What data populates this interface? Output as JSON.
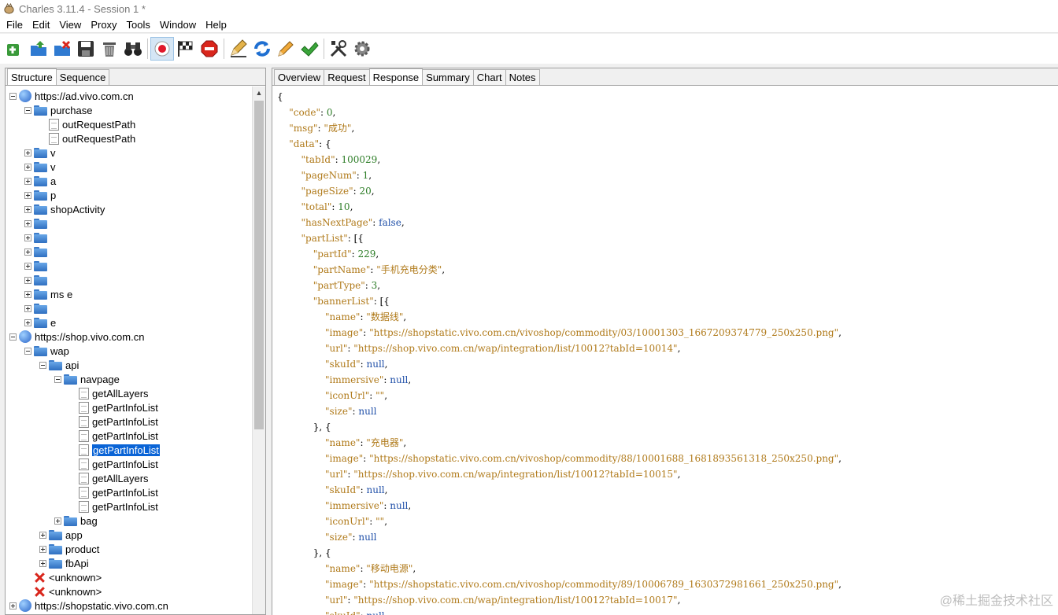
{
  "window": {
    "title": "Charles 3.11.4 - Session 1 *"
  },
  "menu": [
    "File",
    "Edit",
    "View",
    "Proxy",
    "Tools",
    "Window",
    "Help"
  ],
  "toolbar": {
    "buttons": [
      {
        "name": "new-session-icon"
      },
      {
        "name": "open-session-icon"
      },
      {
        "name": "close-session-icon"
      },
      {
        "name": "save-icon"
      },
      {
        "name": "clear-icon"
      },
      {
        "name": "find-icon"
      },
      {
        "name": "record-icon"
      },
      {
        "name": "throttle-icon"
      },
      {
        "name": "breakpoints-icon"
      },
      {
        "name": "compose-icon"
      },
      {
        "name": "repeat-icon"
      },
      {
        "name": "edit-icon"
      },
      {
        "name": "validate-icon"
      },
      {
        "name": "tools-icon"
      },
      {
        "name": "settings-icon"
      }
    ]
  },
  "left_tabs": [
    "Structure",
    "Sequence"
  ],
  "tree": [
    {
      "label": "https://ad.vivo.com.cn",
      "type": "globe",
      "exp": "minus",
      "indent": 0
    },
    {
      "label": "purchase",
      "type": "folder",
      "exp": "minus",
      "indent": 1
    },
    {
      "label": "outRequestPath",
      "type": "file",
      "exp": "none",
      "indent": 2
    },
    {
      "label": "outRequestPath",
      "type": "file",
      "exp": "none",
      "indent": 2
    },
    {
      "label": "v",
      "type": "folder",
      "exp": "plus",
      "indent": 1
    },
    {
      "label": "v",
      "type": "folder",
      "exp": "plus",
      "indent": 1
    },
    {
      "label": "a",
      "type": "folder",
      "exp": "plus",
      "indent": 1
    },
    {
      "label": "p",
      "type": "folder",
      "exp": "plus",
      "indent": 1
    },
    {
      "label": "shopActivity",
      "type": "folder",
      "exp": "plus",
      "indent": 1
    },
    {
      "label": "",
      "type": "folder",
      "exp": "plus",
      "indent": 1
    },
    {
      "label": "",
      "type": "folder",
      "exp": "plus",
      "indent": 1
    },
    {
      "label": "",
      "type": "folder",
      "exp": "plus",
      "indent": 1
    },
    {
      "label": "",
      "type": "folder",
      "exp": "plus",
      "indent": 1
    },
    {
      "label": "",
      "type": "folder",
      "exp": "plus",
      "indent": 1
    },
    {
      "label": "ms e",
      "type": "folder",
      "exp": "plus",
      "indent": 1
    },
    {
      "label": "",
      "type": "folder",
      "exp": "plus",
      "indent": 1
    },
    {
      "label": "e",
      "type": "folder",
      "exp": "plus",
      "indent": 1
    },
    {
      "label": "https://shop.vivo.com.cn",
      "type": "globe",
      "exp": "minus",
      "indent": 0
    },
    {
      "label": "wap",
      "type": "folder",
      "exp": "minus",
      "indent": 1
    },
    {
      "label": "api",
      "type": "folder",
      "exp": "minus",
      "indent": 2
    },
    {
      "label": "navpage",
      "type": "folder",
      "exp": "minus",
      "indent": 3
    },
    {
      "label": "getAllLayers",
      "type": "file",
      "exp": "none",
      "indent": 4
    },
    {
      "label": "getPartInfoList",
      "type": "file",
      "exp": "none",
      "indent": 4
    },
    {
      "label": "getPartInfoList",
      "type": "file",
      "exp": "none",
      "indent": 4
    },
    {
      "label": "getPartInfoList",
      "type": "file",
      "exp": "none",
      "indent": 4
    },
    {
      "label": "getPartInfoList",
      "type": "file",
      "exp": "none",
      "indent": 4,
      "selected": true
    },
    {
      "label": "getPartInfoList",
      "type": "file",
      "exp": "none",
      "indent": 4
    },
    {
      "label": "getAllLayers",
      "type": "file",
      "exp": "none",
      "indent": 4
    },
    {
      "label": "getPartInfoList",
      "type": "file",
      "exp": "none",
      "indent": 4
    },
    {
      "label": "getPartInfoList",
      "type": "file",
      "exp": "none",
      "indent": 4
    },
    {
      "label": "bag",
      "type": "folder",
      "exp": "plus",
      "indent": 3
    },
    {
      "label": "app",
      "type": "folder",
      "exp": "plus",
      "indent": 2
    },
    {
      "label": "product",
      "type": "folder",
      "exp": "plus",
      "indent": 2
    },
    {
      "label": "fbApi",
      "type": "folder",
      "exp": "plus",
      "indent": 2
    },
    {
      "label": "<unknown>",
      "type": "error",
      "exp": "none",
      "indent": 1
    },
    {
      "label": "<unknown>",
      "type": "error",
      "exp": "none",
      "indent": 1
    },
    {
      "label": "https://shopstatic.vivo.com.cn",
      "type": "globe",
      "exp": "plus",
      "indent": 0
    }
  ],
  "right_tabs": [
    "Overview",
    "Request",
    "Response",
    "Summary",
    "Chart",
    "Notes"
  ],
  "response_lines": [
    [
      [
        "p",
        "{"
      ]
    ],
    [
      [
        "p",
        "    "
      ],
      [
        "k",
        "\"code\""
      ],
      [
        "p",
        ": "
      ],
      [
        "n",
        "0"
      ],
      [
        "p",
        ","
      ]
    ],
    [
      [
        "p",
        "    "
      ],
      [
        "k",
        "\"msg\""
      ],
      [
        "p",
        ": "
      ],
      [
        "s",
        "\"成功\""
      ],
      [
        "p",
        ","
      ]
    ],
    [
      [
        "p",
        "    "
      ],
      [
        "k",
        "\"data\""
      ],
      [
        "p",
        ": {"
      ]
    ],
    [
      [
        "p",
        "        "
      ],
      [
        "k",
        "\"tabId\""
      ],
      [
        "p",
        ": "
      ],
      [
        "n",
        "100029"
      ],
      [
        "p",
        ","
      ]
    ],
    [
      [
        "p",
        "        "
      ],
      [
        "k",
        "\"pageNum\""
      ],
      [
        "p",
        ": "
      ],
      [
        "n",
        "1"
      ],
      [
        "p",
        ","
      ]
    ],
    [
      [
        "p",
        "        "
      ],
      [
        "k",
        "\"pageSize\""
      ],
      [
        "p",
        ": "
      ],
      [
        "n",
        "20"
      ],
      [
        "p",
        ","
      ]
    ],
    [
      [
        "p",
        "        "
      ],
      [
        "k",
        "\"total\""
      ],
      [
        "p",
        ": "
      ],
      [
        "n",
        "10"
      ],
      [
        "p",
        ","
      ]
    ],
    [
      [
        "p",
        "        "
      ],
      [
        "k",
        "\"hasNextPage\""
      ],
      [
        "p",
        ": "
      ],
      [
        "b",
        "false"
      ],
      [
        "p",
        ","
      ]
    ],
    [
      [
        "p",
        "        "
      ],
      [
        "k",
        "\"partList\""
      ],
      [
        "p",
        ": [{"
      ]
    ],
    [
      [
        "p",
        "            "
      ],
      [
        "k",
        "\"partId\""
      ],
      [
        "p",
        ": "
      ],
      [
        "n",
        "229"
      ],
      [
        "p",
        ","
      ]
    ],
    [
      [
        "p",
        "            "
      ],
      [
        "k",
        "\"partName\""
      ],
      [
        "p",
        ": "
      ],
      [
        "s",
        "\"手机充电分类\""
      ],
      [
        "p",
        ","
      ]
    ],
    [
      [
        "p",
        "            "
      ],
      [
        "k",
        "\"partType\""
      ],
      [
        "p",
        ": "
      ],
      [
        "n",
        "3"
      ],
      [
        "p",
        ","
      ]
    ],
    [
      [
        "p",
        "            "
      ],
      [
        "k",
        "\"bannerList\""
      ],
      [
        "p",
        ": [{"
      ]
    ],
    [
      [
        "p",
        "                "
      ],
      [
        "k",
        "\"name\""
      ],
      [
        "p",
        ": "
      ],
      [
        "s",
        "\"数据线\""
      ],
      [
        "p",
        ","
      ]
    ],
    [
      [
        "p",
        "                "
      ],
      [
        "k",
        "\"image\""
      ],
      [
        "p",
        ": "
      ],
      [
        "s",
        "\"https://shopstatic.vivo.com.cn/vivoshop/commodity/03/10001303_1667209374779_250x250.png\""
      ],
      [
        "p",
        ","
      ]
    ],
    [
      [
        "p",
        "                "
      ],
      [
        "k",
        "\"url\""
      ],
      [
        "p",
        ": "
      ],
      [
        "s",
        "\"https://shop.vivo.com.cn/wap/integration/list/10012?tabId=10014\""
      ],
      [
        "p",
        ","
      ]
    ],
    [
      [
        "p",
        "                "
      ],
      [
        "k",
        "\"skuId\""
      ],
      [
        "p",
        ": "
      ],
      [
        "b",
        "null"
      ],
      [
        "p",
        ","
      ]
    ],
    [
      [
        "p",
        "                "
      ],
      [
        "k",
        "\"immersive\""
      ],
      [
        "p",
        ": "
      ],
      [
        "b",
        "null"
      ],
      [
        "p",
        ","
      ]
    ],
    [
      [
        "p",
        "                "
      ],
      [
        "k",
        "\"iconUrl\""
      ],
      [
        "p",
        ": "
      ],
      [
        "s",
        "\"\""
      ],
      [
        "p",
        ","
      ]
    ],
    [
      [
        "p",
        "                "
      ],
      [
        "k",
        "\"size\""
      ],
      [
        "p",
        ": "
      ],
      [
        "b",
        "null"
      ]
    ],
    [
      [
        "p",
        "            }, {"
      ]
    ],
    [
      [
        "p",
        "                "
      ],
      [
        "k",
        "\"name\""
      ],
      [
        "p",
        ": "
      ],
      [
        "s",
        "\"充电器\""
      ],
      [
        "p",
        ","
      ]
    ],
    [
      [
        "p",
        "                "
      ],
      [
        "k",
        "\"image\""
      ],
      [
        "p",
        ": "
      ],
      [
        "s",
        "\"https://shopstatic.vivo.com.cn/vivoshop/commodity/88/10001688_1681893561318_250x250.png\""
      ],
      [
        "p",
        ","
      ]
    ],
    [
      [
        "p",
        "                "
      ],
      [
        "k",
        "\"url\""
      ],
      [
        "p",
        ": "
      ],
      [
        "s",
        "\"https://shop.vivo.com.cn/wap/integration/list/10012?tabId=10015\""
      ],
      [
        "p",
        ","
      ]
    ],
    [
      [
        "p",
        "                "
      ],
      [
        "k",
        "\"skuId\""
      ],
      [
        "p",
        ": "
      ],
      [
        "b",
        "null"
      ],
      [
        "p",
        ","
      ]
    ],
    [
      [
        "p",
        "                "
      ],
      [
        "k",
        "\"immersive\""
      ],
      [
        "p",
        ": "
      ],
      [
        "b",
        "null"
      ],
      [
        "p",
        ","
      ]
    ],
    [
      [
        "p",
        "                "
      ],
      [
        "k",
        "\"iconUrl\""
      ],
      [
        "p",
        ": "
      ],
      [
        "s",
        "\"\""
      ],
      [
        "p",
        ","
      ]
    ],
    [
      [
        "p",
        "                "
      ],
      [
        "k",
        "\"size\""
      ],
      [
        "p",
        ": "
      ],
      [
        "b",
        "null"
      ]
    ],
    [
      [
        "p",
        "            }, {"
      ]
    ],
    [
      [
        "p",
        "                "
      ],
      [
        "k",
        "\"name\""
      ],
      [
        "p",
        ": "
      ],
      [
        "s",
        "\"移动电源\""
      ],
      [
        "p",
        ","
      ]
    ],
    [
      [
        "p",
        "                "
      ],
      [
        "k",
        "\"image\""
      ],
      [
        "p",
        ": "
      ],
      [
        "s",
        "\"https://shopstatic.vivo.com.cn/vivoshop/commodity/89/10006789_1630372981661_250x250.png\""
      ],
      [
        "p",
        ","
      ]
    ],
    [
      [
        "p",
        "                "
      ],
      [
        "k",
        "\"url\""
      ],
      [
        "p",
        ": "
      ],
      [
        "s",
        "\"https://shop.vivo.com.cn/wap/integration/list/10012?tabId=10017\""
      ],
      [
        "p",
        ","
      ]
    ],
    [
      [
        "p",
        "                "
      ],
      [
        "k",
        "\"skuId\""
      ],
      [
        "p",
        ": "
      ],
      [
        "b",
        "null"
      ]
    ]
  ],
  "watermark": "@稀土掘金技术社区"
}
